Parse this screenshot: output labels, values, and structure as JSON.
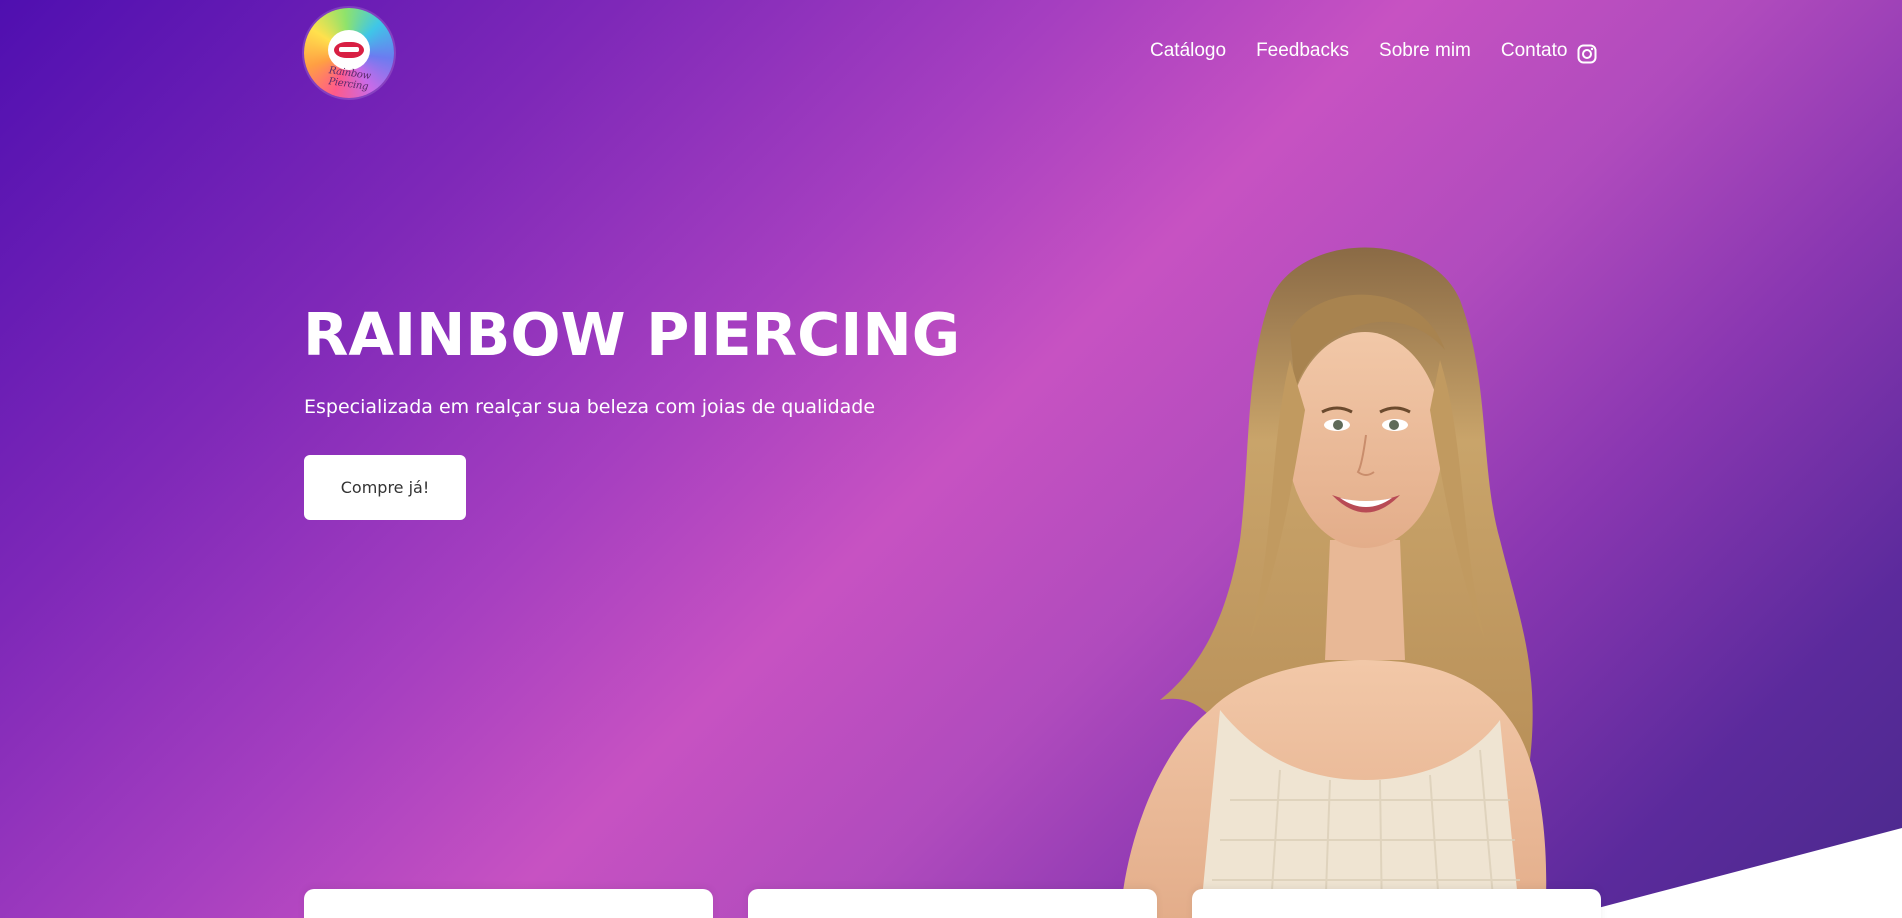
{
  "brand": {
    "logo_text": "Rainbow Piercing"
  },
  "nav": {
    "items": [
      {
        "label": "Catálogo"
      },
      {
        "label": "Feedbacks"
      },
      {
        "label": "Sobre mim"
      },
      {
        "label": "Contato"
      }
    ],
    "social_icon": "instagram-icon"
  },
  "hero": {
    "title": "RAINBOW PIERCING",
    "subtitle": "Especializada em realçar sua beleza com joias de qualidade",
    "cta_label": "Compre já!",
    "image": "smiling-woman-photo"
  },
  "colors": {
    "gradient_start": "#4f0fb0",
    "gradient_mid": "#c752c2",
    "gradient_end": "#4a2a8c",
    "text": "#ffffff",
    "button_bg": "#ffffff",
    "button_text": "#333333"
  },
  "cards": [
    {
      "id": "card-1"
    },
    {
      "id": "card-2"
    },
    {
      "id": "card-3"
    }
  ]
}
